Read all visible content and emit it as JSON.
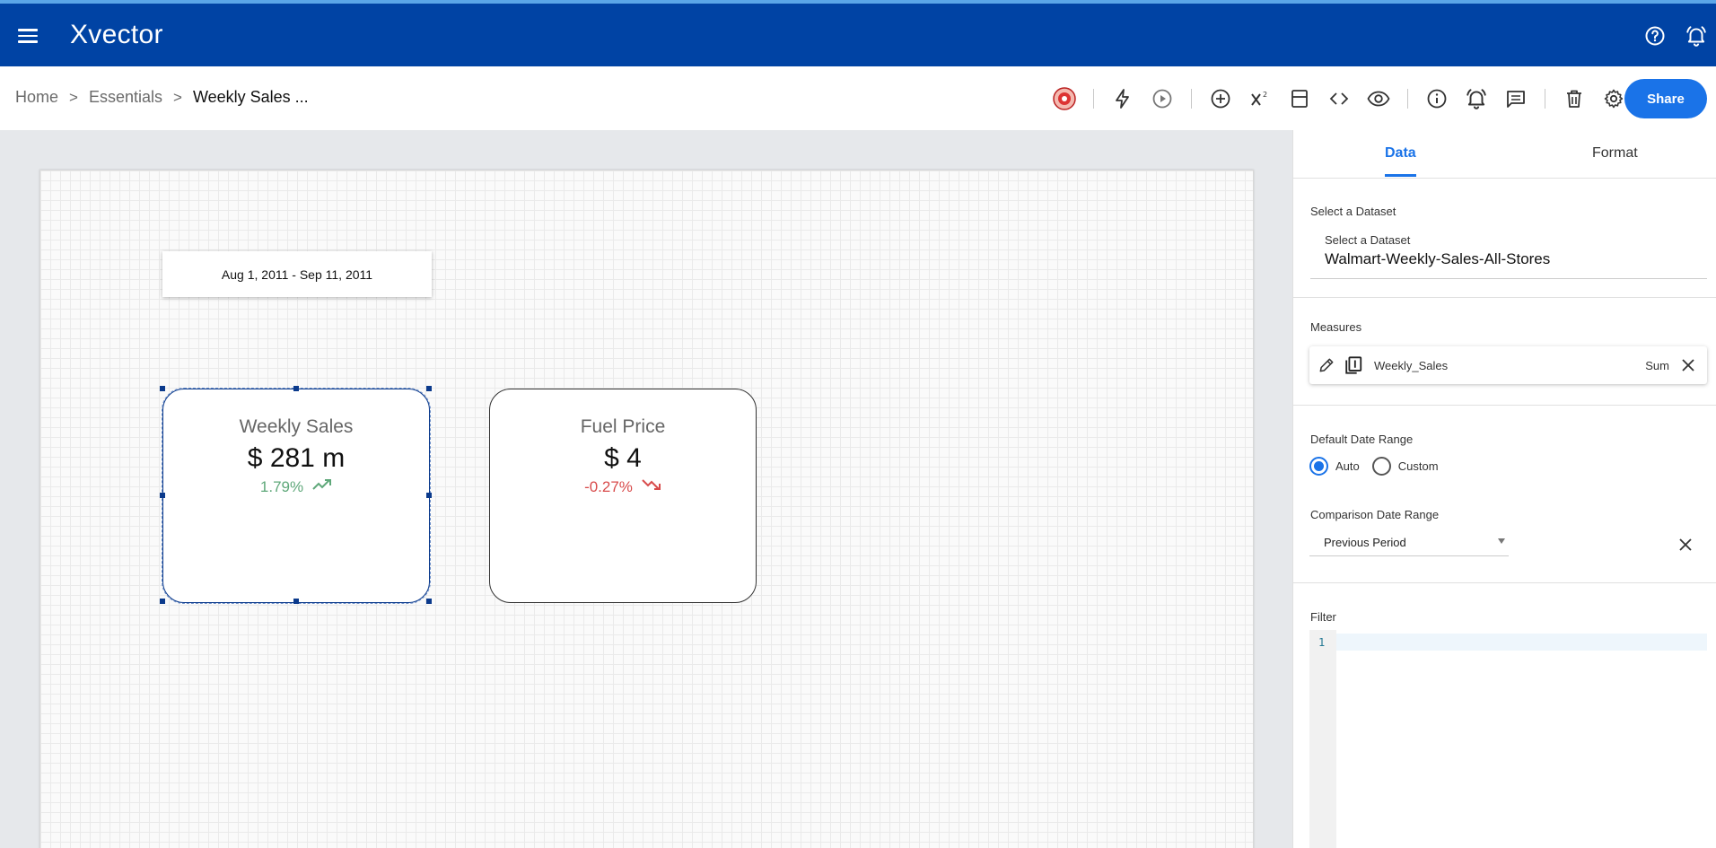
{
  "app": {
    "logo_text": "Xvector",
    "menu_icon": "hamburger-menu-icon",
    "help_icon": "help-circle-icon",
    "notifications_icon": "bell-icon"
  },
  "breadcrumb": {
    "items": [
      "Home",
      "Essentials"
    ],
    "current": "Weekly Sales ...",
    "separator": ">"
  },
  "toolbar": {
    "icons": [
      "app-logo-icon",
      "lightning-icon",
      "play-icon",
      "add-icon",
      "superscript-icon",
      "layout-icon",
      "code-icon",
      "eye-icon",
      "info-icon",
      "alert-bell-icon",
      "comment-icon",
      "trash-icon",
      "gear-icon"
    ],
    "share_label": "Share",
    "share_color": "#1a73e8"
  },
  "canvas": {
    "date_range": "Aug 1, 2011 - Sep 11, 2011",
    "kpis": [
      {
        "title": "Weekly Sales",
        "value": "$ 281 m",
        "change": "1.79%",
        "trend": "up",
        "color": "#5fa87a"
      },
      {
        "title": "Fuel Price",
        "value": "$ 4",
        "change": "-0.27%",
        "trend": "down",
        "color": "#d84b4b"
      }
    ]
  },
  "panel": {
    "tabs": [
      "Data",
      "Format"
    ],
    "active_tab": "Data",
    "dataset_section_label": "Select a Dataset",
    "dataset_field_label": "Select a Dataset",
    "dataset_value": "Walmart-Weekly-Sales-All-Stores",
    "measures_label": "Measures",
    "measure": {
      "name": "Weekly_Sales",
      "aggregation": "Sum"
    },
    "default_date_range_label": "Default Date Range",
    "radio_options": [
      "Auto",
      "Custom"
    ],
    "radio_selected": "Auto",
    "comparison_label": "Comparison Date Range",
    "comparison_value": "Previous Period",
    "filter_label": "Filter",
    "filter_line_number": "1"
  }
}
